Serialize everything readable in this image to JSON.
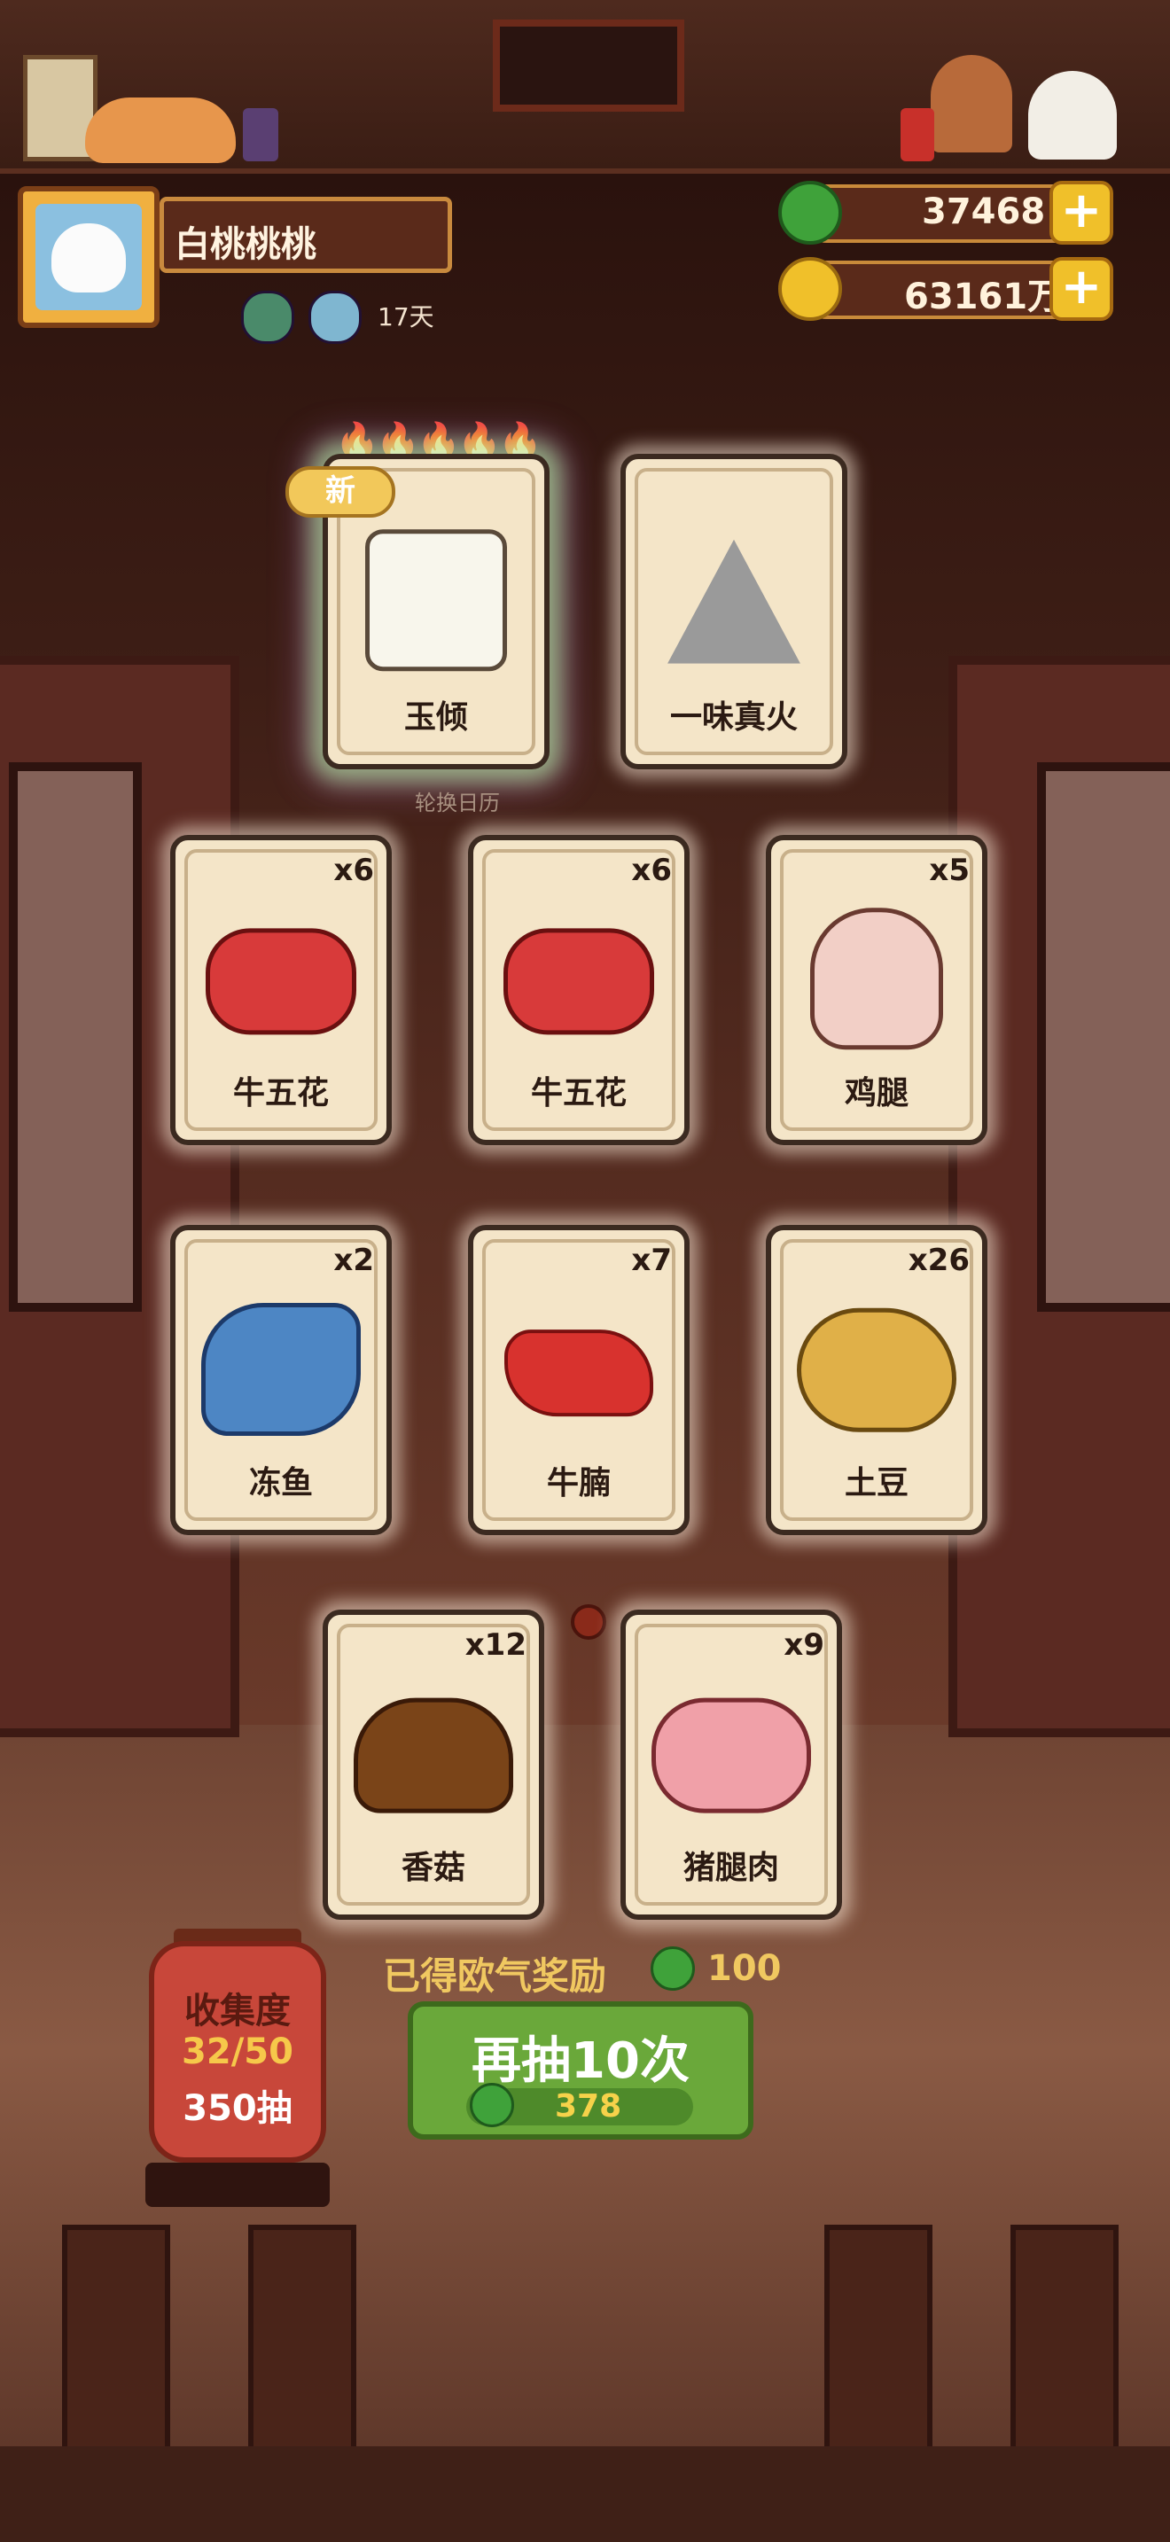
{
  "player": {
    "name": "白桃桃桃",
    "days": "17天"
  },
  "currency": {
    "jade": "37468",
    "coins": "63161万"
  },
  "special_cards": [
    {
      "name": "玉倾",
      "badge": "新",
      "flames": 5
    },
    {
      "name": "一味真火"
    }
  ],
  "calendar_label": "轮换日历",
  "cards": [
    {
      "name": "牛五花",
      "count": "x6",
      "icon": "pork-belly-icon"
    },
    {
      "name": "牛五花",
      "count": "x6",
      "icon": "pork-belly-icon"
    },
    {
      "name": "鸡腿",
      "count": "x5",
      "icon": "chicken-leg-icon"
    },
    {
      "name": "冻鱼",
      "count": "x2",
      "icon": "frozen-fish-icon"
    },
    {
      "name": "牛腩",
      "count": "x7",
      "icon": "beef-brisket-icon"
    },
    {
      "name": "土豆",
      "count": "x26",
      "icon": "potato-icon"
    },
    {
      "name": "香菇",
      "count": "x12",
      "icon": "mushroom-icon"
    },
    {
      "name": "猪腿肉",
      "count": "x9",
      "icon": "pork-leg-icon"
    }
  ],
  "luck_reward": {
    "label": "已得欧气奖励",
    "value": "100"
  },
  "collection": {
    "title": "收集度",
    "progress": "32/50",
    "draws": "350抽"
  },
  "redraw_button": {
    "label": "再抽10次",
    "cost": "378"
  },
  "colors": {
    "jade_green": "#3fa23a",
    "gold": "#f0c02a",
    "card_bg": "#f4e5c8",
    "lantern_red": "#c8473a",
    "button_green": "#6aa83a"
  }
}
